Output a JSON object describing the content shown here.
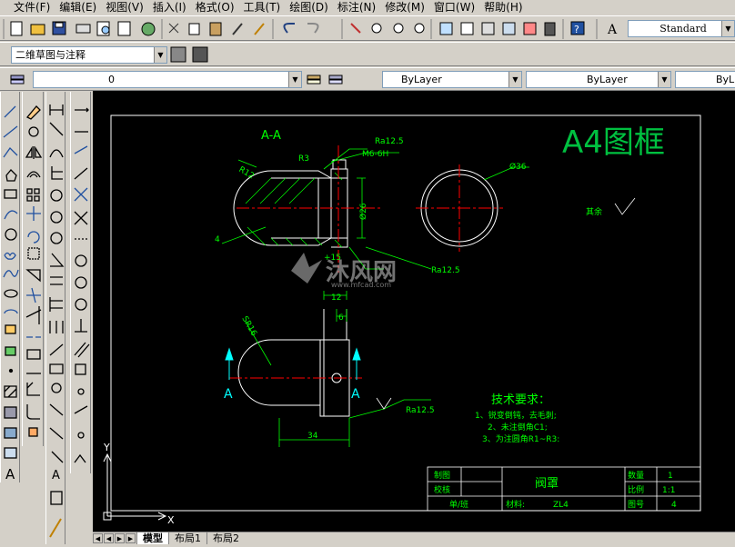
{
  "menu": [
    "文件(F)",
    "编辑(E)",
    "视图(V)",
    "插入(I)",
    "格式(O)",
    "工具(T)",
    "绘图(D)",
    "标注(N)",
    "修改(M)",
    "窗口(W)",
    "帮助(H)"
  ],
  "toolbar": {
    "text_style": "Standard",
    "workspace": "二维草图与注释",
    "layer_value": "0",
    "color_value": "ByLayer",
    "linetype_value": "ByLayer",
    "lineweight_value": "ByL"
  },
  "colors": {
    "background": "#000000",
    "drawing_line": "#ffffff",
    "dimension": "#00ff00",
    "centerline": "#ff0000",
    "section_label": "#00ffff",
    "title_big": "#00c040"
  },
  "drawing": {
    "title": "A4图框",
    "section_label": "A-A",
    "dims": {
      "ra1": "Ra12.5",
      "thread": "M6-6H",
      "r3": "R3",
      "r12": "R12",
      "four": "4",
      "phi26": "Ø26",
      "phi36": "Ø36",
      "plus15": "+15",
      "ra2": "Ra12.5",
      "d12": "12",
      "d6": "6",
      "sr16": "SR16",
      "d34": "34",
      "ra3": "Ra12.5",
      "rest": "其余",
      "arrow_a": "A"
    },
    "tech_title": "技术要求：",
    "tech_items": [
      "1、锐变倒钝，去毛刺;",
      "2、未注倒角C1;",
      "3、为注圆角R1~R3:"
    ],
    "title_block": {
      "draw": "制图",
      "check": "校核",
      "part": "阀罩",
      "qty_label": "数量",
      "qty": "1",
      "scale_label": "比例",
      "scale": "1:1",
      "dwg_label": "图号",
      "dwg": "4",
      "unit": "单/班",
      "material_label": "材料:",
      "material": "ZL4"
    },
    "watermark": "沐风网",
    "watermark_url": "www.mfcad.com"
  },
  "tabs": [
    "模型",
    "布局1",
    "布局2"
  ],
  "ucs": {
    "x": "X",
    "y": "Y"
  }
}
